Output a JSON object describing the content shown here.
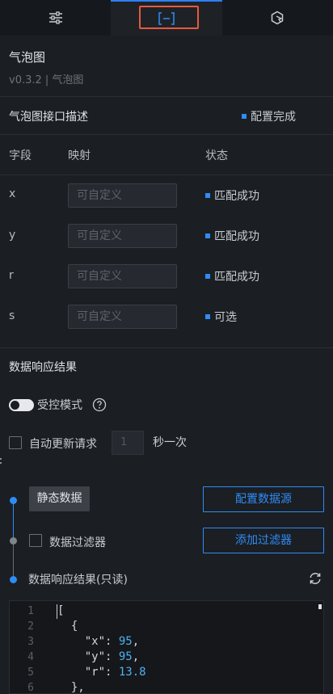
{
  "tabs": [
    {
      "icon": "sliders-icon"
    },
    {
      "icon": "bracket-data-icon",
      "active": true
    },
    {
      "icon": "interaction-icon"
    }
  ],
  "header": {
    "title": "气泡图",
    "subtitle": "v0.3.2 | 气泡图"
  },
  "interface": {
    "title": "气泡图接口描述",
    "status": "配置完成",
    "columns": {
      "field": "字段",
      "mapping": "映射",
      "status": "状态"
    },
    "rows": [
      {
        "field": "x",
        "placeholder": "可自定义",
        "status": "匹配成功"
      },
      {
        "field": "y",
        "placeholder": "可自定义",
        "status": "匹配成功"
      },
      {
        "field": "r",
        "placeholder": "可自定义",
        "status": "匹配成功"
      },
      {
        "field": "s",
        "placeholder": "可自定义",
        "status": "可选"
      }
    ]
  },
  "response": {
    "title": "数据响应结果",
    "controlled_mode_label": "受控模式",
    "controlled_mode_on": false,
    "auto_update_label": "自动更新请求",
    "auto_update_interval": "1",
    "auto_update_unit": "秒一次",
    "static_data_label": "静态数据",
    "config_source_button": "配置数据源",
    "filter_label": "数据过滤器",
    "add_filter_button": "添加过滤器",
    "result_label": "数据响应结果(只读)"
  },
  "editor": {
    "lines": [
      {
        "num": "1",
        "text": "["
      },
      {
        "num": "2",
        "text": "  {"
      },
      {
        "num": "3",
        "key": "    \"x\": ",
        "value": "95",
        "tail": ","
      },
      {
        "num": "4",
        "key": "    \"y\": ",
        "value": "95",
        "tail": ","
      },
      {
        "num": "5",
        "key": "    \"r\": ",
        "value": "13.8",
        "tail": ""
      },
      {
        "num": "6",
        "text": "  },"
      }
    ]
  },
  "colors": {
    "accent": "#2f8cf6",
    "highlight": "#e6583e",
    "background": "#1b1e23"
  }
}
